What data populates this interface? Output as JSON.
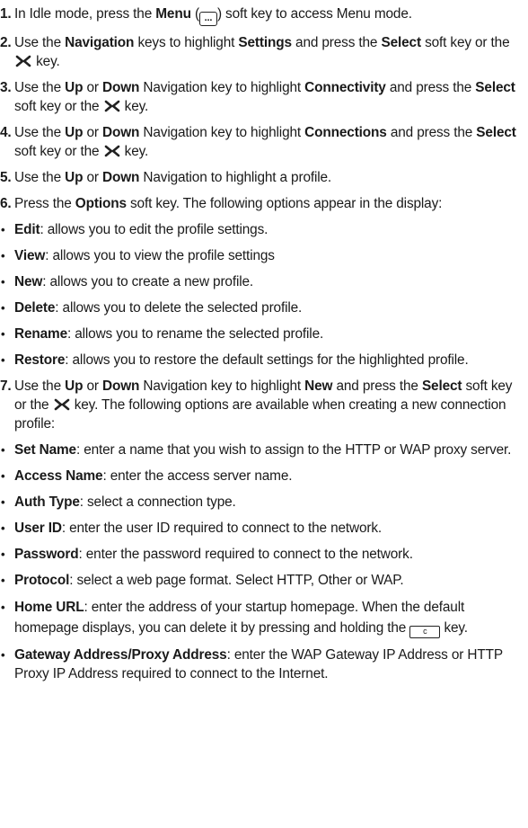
{
  "icons": {
    "menu_key": "...",
    "clear_key": "c"
  },
  "s1": {
    "num": "1.",
    "a": "In Idle mode, press the ",
    "b": "Menu",
    "c": " (",
    "d": ") soft key to access Menu mode."
  },
  "s2": {
    "num": "2.",
    "a": "Use the ",
    "b": "Navigation",
    "c": " keys to highlight ",
    "d": "Settings",
    "e": " and press the ",
    "f": "Select",
    "g": " soft key or the ",
    "h": " key."
  },
  "s3": {
    "num": "3.",
    "a": "Use the ",
    "b": "Up",
    "c": " or ",
    "d": "Down",
    "e": " Navigation key to highlight ",
    "f": "Connectivity",
    "g": " and press the ",
    "h": "Select",
    "i": " soft key or the ",
    "j": " key."
  },
  "s4": {
    "num": "4.",
    "a": "Use the ",
    "b": "Up",
    "c": " or ",
    "d": "Down",
    "e": " Navigation key to highlight ",
    "f": "Connections",
    "g": " and press the ",
    "h": "Select",
    "i": " soft key or the ",
    "j": " key."
  },
  "s5": {
    "num": "5.",
    "a": "Use the ",
    "b": "Up",
    "c": " or ",
    "d": "Down",
    "e": " Navigation to highlight a profile."
  },
  "s6": {
    "num": "6.",
    "a": "Press the ",
    "b": "Options",
    "c": " soft key. The following options appear in the display:"
  },
  "opts": [
    {
      "term": "Edit",
      "desc": ": allows you to edit the profile settings."
    },
    {
      "term": "View",
      "desc": ": allows you to view the profile settings"
    },
    {
      "term": "New",
      "desc": ": allows you to create a new profile."
    },
    {
      "term": "Delete",
      "desc": ": allows you to delete the selected profile."
    },
    {
      "term": "Rename",
      "desc": ": allows you to rename the selected profile."
    },
    {
      "term": "Restore",
      "desc": ": allows you to restore the default settings for the highlighted profile."
    }
  ],
  "s7": {
    "num": "7.",
    "a": "Use the ",
    "b": "Up",
    "c": " or ",
    "d": "Down",
    "e": " Navigation key to highlight ",
    "f": "New",
    "g": " and press the ",
    "h": "Select",
    "i": " soft key or the ",
    "j": " key. The following options are available when creating a new connection profile:"
  },
  "fields": [
    {
      "term": "Set Name",
      "desc": ": enter a name that you wish to assign to the HTTP or WAP proxy server."
    },
    {
      "term": "Access Name",
      "desc": ": enter the access server name."
    },
    {
      "term": "Auth Type",
      "desc": ": select a connection type."
    },
    {
      "term": "User ID",
      "desc": ": enter the user ID required to connect to the network."
    },
    {
      "term": "Password",
      "desc": ": enter the password required to connect to the network."
    },
    {
      "term": "Protocol",
      "desc": ": select a web page format. Select HTTP, Other or WAP."
    }
  ],
  "home": {
    "term": "Home URL",
    "a": ": enter the address of your startup homepage. When the default homepage displays, you can delete it by pressing and holding the ",
    "b": " key."
  },
  "gateway": {
    "term": "Gateway Address/Proxy Address",
    "desc": ": enter the WAP Gateway IP Address or HTTP Proxy IP Address required to connect to the Internet."
  },
  "bullet_char": "•"
}
